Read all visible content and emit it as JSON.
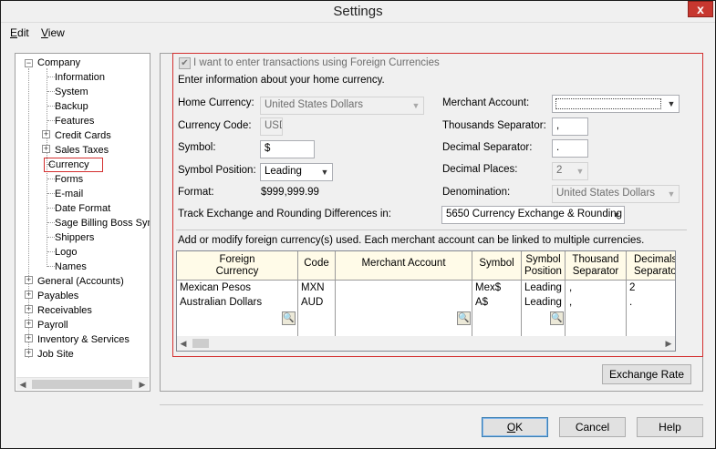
{
  "window": {
    "title": "Settings",
    "close_label": "x"
  },
  "menu": {
    "edit": "Edit",
    "view": "View"
  },
  "tree": {
    "company": "Company",
    "children": [
      "Information",
      "System",
      "Backup",
      "Features",
      "Credit Cards",
      "Sales Taxes",
      "Currency",
      "Forms",
      "E-mail",
      "Date Format",
      "Sage Billing Boss Syn",
      "Shippers",
      "Logo",
      "Names"
    ],
    "roots": [
      "General (Accounts)",
      "Payables",
      "Receivables",
      "Payroll",
      "Inventory & Services",
      "Job Site"
    ]
  },
  "currency": {
    "checkbox_label": "I want to enter transactions using Foreign Currencies",
    "intro": "Enter information about your home currency.",
    "home_currency_label": "Home Currency:",
    "home_currency_value": "United States Dollars",
    "currency_code_label": "Currency Code:",
    "currency_code_value": "USD",
    "symbol_label": "Symbol:",
    "symbol_value": "$",
    "symbol_position_label": "Symbol Position:",
    "symbol_position_value": "Leading",
    "format_label": "Format:",
    "format_value": "$999,999.99",
    "merchant_account_label": "Merchant Account:",
    "merchant_account_value": "",
    "thousands_sep_label": "Thousands Separator:",
    "thousands_sep_value": ",",
    "decimal_sep_label": "Decimal Separator:",
    "decimal_sep_value": ".",
    "decimal_places_label": "Decimal Places:",
    "decimal_places_value": "2",
    "denomination_label": "Denomination:",
    "denomination_value": "United States Dollars",
    "track_label": "Track Exchange and Rounding Differences in:",
    "track_value": "5650 Currency Exchange & Rounding",
    "foreign_intro": "Add or modify foreign currency(s) used. Each merchant account can be linked to multiple currencies."
  },
  "grid": {
    "headers": {
      "foreign_line1": "Foreign",
      "foreign_line2": "Currency",
      "code": "Code",
      "merchant": "Merchant Account",
      "symbol": "Symbol",
      "symbol_pos_line1": "Symbol",
      "symbol_pos_line2": "Position",
      "thousand_line1": "Thousand",
      "thousand_line2": "Separator",
      "decimals_line1": "Decimals",
      "decimals_line2": "Separator"
    },
    "rows": [
      {
        "currency": "Mexican Pesos",
        "code": "MXN",
        "merchant": "",
        "symbol": "Mex$",
        "position": "Leading",
        "thousand": ",",
        "decimal": "2"
      },
      {
        "currency": "Australian Dollars",
        "code": "AUD",
        "merchant": "",
        "symbol": "A$",
        "position": "Leading",
        "thousand": ",",
        "decimal": "."
      }
    ]
  },
  "buttons": {
    "exchange_rate": "Exchange Rate",
    "ok": "OK",
    "cancel": "Cancel",
    "help": "Help"
  },
  "icons": {
    "lookup": "magnifier-icon",
    "expand": "plus",
    "collapse": "minus"
  }
}
